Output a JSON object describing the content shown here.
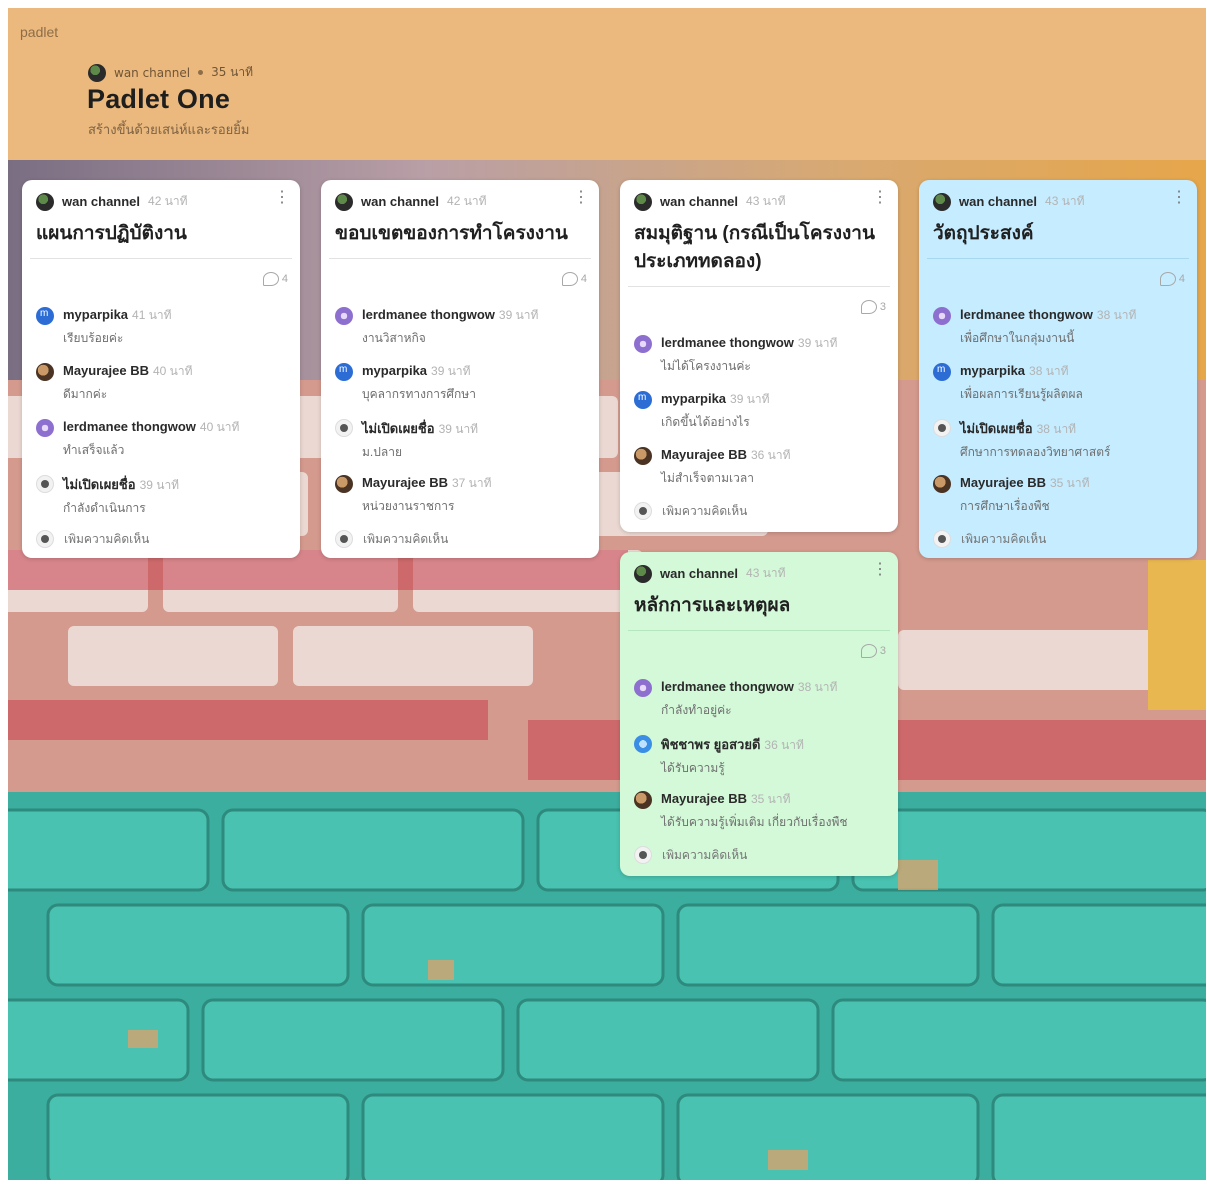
{
  "app": {
    "brand": "padlet"
  },
  "header": {
    "owner": "wan channel",
    "time": "35 นาที",
    "title": "Padlet One",
    "subtitle": "สร้างขึ้นด้วยเสน่ห์และรอยยิ้ม"
  },
  "colors": {
    "header_bg": "#ebb97d",
    "card_white": "#ffffff",
    "card_blue": "#c6ecff",
    "card_green": "#d4f9d9"
  },
  "cards": [
    {
      "author": "wan channel",
      "time": "42 นาที",
      "title": "แผนการปฏิบัติงาน",
      "comment_count": "4",
      "comments": [
        {
          "name": "myparpika",
          "time": "41 นาที",
          "text": "เรียบร้อยค่ะ",
          "avatar": "avatar-m-icon"
        },
        {
          "name": "Mayurajee BB",
          "time": "40 นาที",
          "text": "ดีมากค่ะ",
          "avatar": "avatar-photo-icon"
        },
        {
          "name": "lerdmanee thongwow",
          "time": "40 นาที",
          "text": "ทำเสร็จแล้ว",
          "avatar": "avatar-flower-icon"
        },
        {
          "name": "ไม่เปิดเผยชื่อ",
          "time": "39 นาที",
          "text": "กำลังดำเนินการ",
          "avatar": "avatar-anonymous-icon"
        }
      ],
      "add_placeholder": "เพิ่มความคิดเห็น"
    },
    {
      "author": "wan channel",
      "time": "42 นาที",
      "title": "ขอบเขตของการทำโครงงาน",
      "comment_count": "4",
      "comments": [
        {
          "name": "lerdmanee thongwow",
          "time": "39 นาที",
          "text": "งานวิสาหกิจ",
          "avatar": "avatar-flower-icon"
        },
        {
          "name": "myparpika",
          "time": "39 นาที",
          "text": "บุคลากรทางการศึกษา",
          "avatar": "avatar-m-icon"
        },
        {
          "name": "ไม่เปิดเผยชื่อ",
          "time": "39 นาที",
          "text": "ม.ปลาย",
          "avatar": "avatar-anonymous-icon"
        },
        {
          "name": "Mayurajee BB",
          "time": "37 นาที",
          "text": "หน่วยงานราชการ",
          "avatar": "avatar-photo-icon"
        }
      ],
      "add_placeholder": "เพิ่มความคิดเห็น"
    },
    {
      "author": "wan channel",
      "time": "43 นาที",
      "title": "สมมุติฐาน (กรณีเป็นโครงงานประเภททดลอง)",
      "comment_count": "3",
      "comments": [
        {
          "name": "lerdmanee thongwow",
          "time": "39 นาที",
          "text": "ไม่ได้โครงงานค่ะ",
          "avatar": "avatar-flower-icon"
        },
        {
          "name": "myparpika",
          "time": "39 นาที",
          "text": "เกิดขึ้นได้อย่างไร",
          "avatar": "avatar-m-icon"
        },
        {
          "name": "Mayurajee BB",
          "time": "36 นาที",
          "text": "ไม่สำเร็จตามเวลา",
          "avatar": "avatar-photo-icon"
        }
      ],
      "add_placeholder": "เพิ่มความคิดเห็น"
    },
    {
      "author": "wan channel",
      "time": "43 นาที",
      "title": "วัตถุประสงค์",
      "comment_count": "4",
      "comments": [
        {
          "name": "lerdmanee thongwow",
          "time": "38 นาที",
          "text": "เพื่อศึกษาในกลุ่มงานนี้",
          "avatar": "avatar-flower-icon"
        },
        {
          "name": "myparpika",
          "time": "38 นาที",
          "text": "เพื่อผลการเรียนรู้ผลิตผล",
          "avatar": "avatar-m-icon"
        },
        {
          "name": "ไม่เปิดเผยชื่อ",
          "time": "38 นาที",
          "text": "ศึกษาการทดลองวิทยาศาสตร์",
          "avatar": "avatar-anonymous-icon"
        },
        {
          "name": "Mayurajee BB",
          "time": "35 นาที",
          "text": "การศึกษาเรื่องพืช",
          "avatar": "avatar-photo-icon"
        }
      ],
      "add_placeholder": "เพิ่มความคิดเห็น"
    },
    {
      "author": "wan channel",
      "time": "43 นาที",
      "title": "หลักการและเหตุผล",
      "comment_count": "3",
      "comments": [
        {
          "name": "lerdmanee thongwow",
          "time": "38 นาที",
          "text": "กำลังทำอยู่ค่ะ",
          "avatar": "avatar-flower-icon"
        },
        {
          "name": "พิชชาพร ยูอสวยดี",
          "time": "36 นาที",
          "text": "ได้รับความรู้",
          "avatar": "avatar-globe-icon"
        },
        {
          "name": "Mayurajee BB",
          "time": "35 นาที",
          "text": "ได้รับความรู้เพิ่มเติม เกี่ยวกับเรื่องพืช",
          "avatar": "avatar-photo-icon"
        }
      ],
      "add_placeholder": "เพิ่มความคิดเห็น"
    }
  ]
}
